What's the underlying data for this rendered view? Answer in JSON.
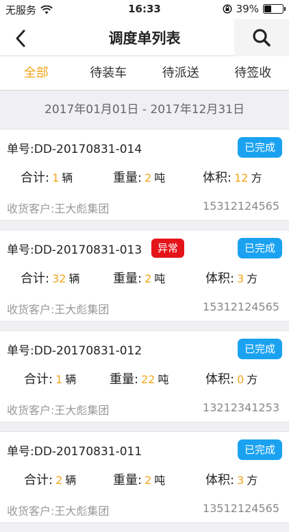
{
  "status": {
    "carrier": "无服务",
    "time": "16:33",
    "battery": "39%",
    "battery_level": 0.39
  },
  "nav": {
    "title": "调度单列表"
  },
  "tabs": [
    {
      "label": "全部",
      "active": true
    },
    {
      "label": "待装车",
      "active": false
    },
    {
      "label": "待派送",
      "active": false
    },
    {
      "label": "待签收",
      "active": false
    }
  ],
  "date_range": "2017年01月01日 - 2017年12月31日",
  "labels": {
    "order_prefix": "单号:",
    "total": "合计:",
    "weight": "重量:",
    "volume": "体积:",
    "unit_vehicle": "辆",
    "unit_ton": "吨",
    "unit_cube": "方",
    "customer_prefix": "收货客户:",
    "status_done": "已完成",
    "status_abnormal": "异常"
  },
  "colors": {
    "accent": "#f3a51c",
    "badge_done": "#1aa2f0",
    "badge_abnormal": "#e5141a"
  },
  "orders": [
    {
      "no": "DD-20170831-014",
      "abnormal": false,
      "total": "1",
      "weight": "2",
      "volume": "12",
      "customer": "王大彪集团",
      "phone": "15312124565"
    },
    {
      "no": "DD-20170831-013",
      "abnormal": true,
      "total": "32",
      "weight": "2",
      "volume": "3",
      "customer": "王大彪集团",
      "phone": "15312124565"
    },
    {
      "no": "DD-20170831-012",
      "abnormal": false,
      "total": "1",
      "weight": "22",
      "volume": "0",
      "customer": "王大彪集团",
      "phone": "13212341253"
    },
    {
      "no": "DD-20170831-011",
      "abnormal": false,
      "total": "2",
      "weight": "2",
      "volume": "3",
      "customer": "王大彪集团",
      "phone": "13512124565"
    }
  ]
}
